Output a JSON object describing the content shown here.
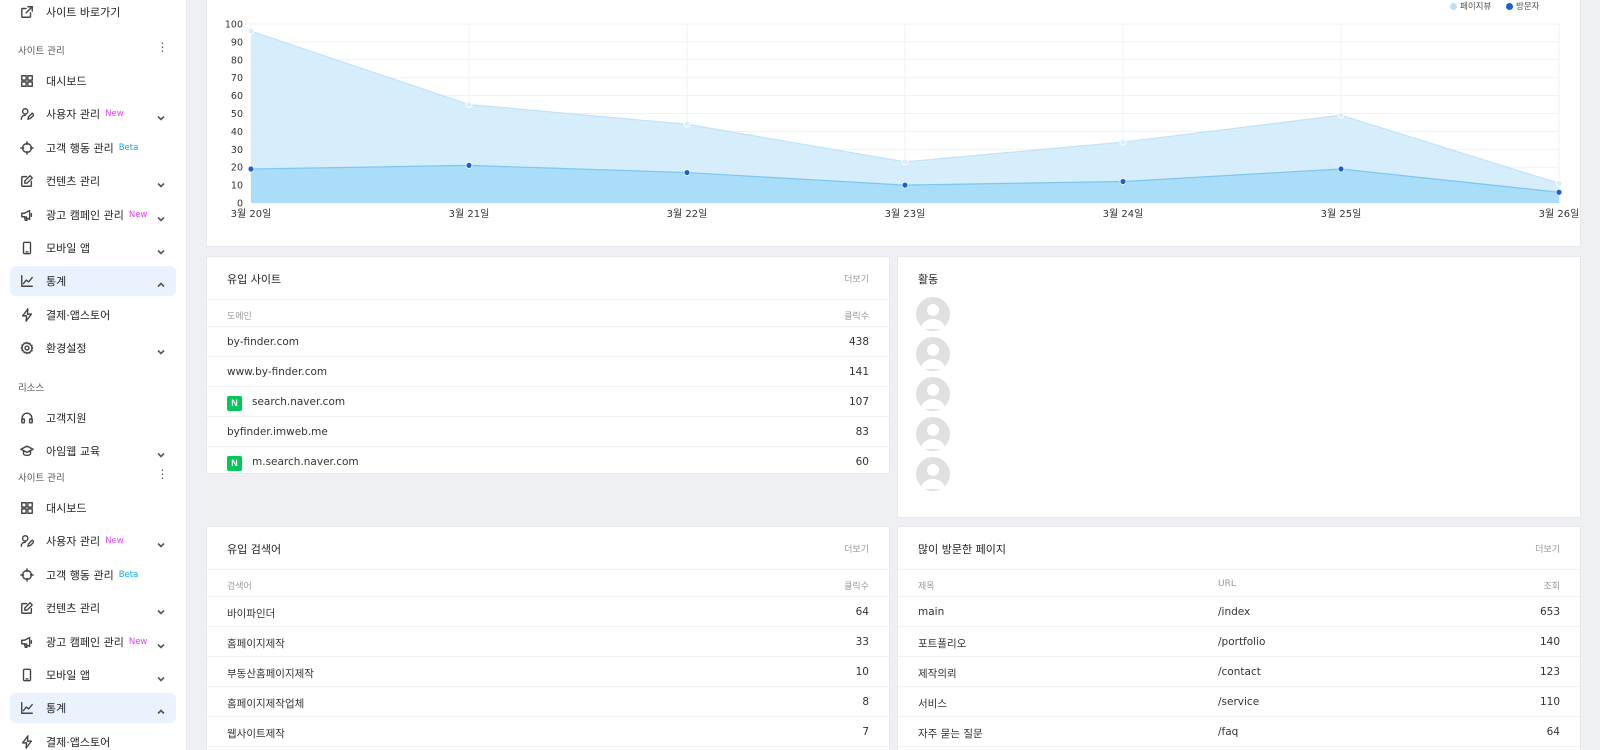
{
  "sidebar": {
    "top_link": "사이트 바로가기",
    "section1": "사이트 관리",
    "menu1": [
      {
        "label": "대시보드",
        "icon": "dashboard-icon",
        "badge": "",
        "chevron": ""
      },
      {
        "label": "사용자 관리",
        "icon": "user-edit-icon",
        "badge": "New",
        "chevron": "down"
      },
      {
        "label": "고객 행동 관리",
        "icon": "target-icon",
        "badge": "Beta",
        "chevron": ""
      },
      {
        "label": "컨텐츠 관리",
        "icon": "edit-icon",
        "badge": "",
        "chevron": "down"
      },
      {
        "label": "광고 캠페인 관리",
        "icon": "megaphone-icon",
        "badge": "New",
        "chevron": "down"
      },
      {
        "label": "모바일 앱",
        "icon": "mobile-icon",
        "badge": "",
        "chevron": "down"
      },
      {
        "label": "통계",
        "icon": "chart-line-icon",
        "badge": "",
        "chevron": "up"
      },
      {
        "label": "결제·앱스토어",
        "icon": "lightning-icon",
        "badge": "",
        "chevron": ""
      },
      {
        "label": "환경설정",
        "icon": "gear-icon",
        "badge": "",
        "chevron": "down"
      }
    ],
    "section2": "리소스",
    "menu2": [
      {
        "label": "고객지원",
        "icon": "headset-icon",
        "badge": "",
        "chevron": ""
      },
      {
        "label": "아임웹 교육",
        "icon": "graduation-cap-icon",
        "badge": "",
        "chevron": "down"
      }
    ],
    "section3": "사이트 관리",
    "menu3": [
      {
        "label": "대시보드",
        "icon": "dashboard-icon",
        "badge": "",
        "chevron": ""
      },
      {
        "label": "사용자 관리",
        "icon": "user-edit-icon",
        "badge": "New",
        "chevron": "down"
      },
      {
        "label": "고객 행동 관리",
        "icon": "target-icon",
        "badge": "Beta",
        "chevron": ""
      },
      {
        "label": "컨텐츠 관리",
        "icon": "edit-icon",
        "badge": "",
        "chevron": "down"
      },
      {
        "label": "광고 캠페인 관리",
        "icon": "megaphone-icon",
        "badge": "New",
        "chevron": "down"
      },
      {
        "label": "모바일 앱",
        "icon": "mobile-icon",
        "badge": "",
        "chevron": "down"
      },
      {
        "label": "통계",
        "icon": "chart-line-icon",
        "badge": "",
        "chevron": "up"
      },
      {
        "label": "결제·앱스토어",
        "icon": "lightning-icon",
        "badge": "",
        "chevron": ""
      }
    ]
  },
  "chart_data": {
    "type": "area",
    "categories": [
      "3월 20일",
      "3월 21일",
      "3월 22일",
      "3월 23일",
      "3월 24일",
      "3월 25일",
      "3월 26일"
    ],
    "series": [
      {
        "name": "페이지뷰",
        "values": [
          96,
          55,
          44,
          23,
          34,
          49,
          11
        ],
        "color": "#b9e0fa"
      },
      {
        "name": "방문자",
        "values": [
          19,
          21,
          17,
          10,
          12,
          19,
          6
        ],
        "color": "#1a5fd6"
      }
    ],
    "ylim": [
      0,
      100
    ],
    "yticks": [
      "0",
      "10",
      "20",
      "30",
      "40",
      "50",
      "60",
      "70",
      "80",
      "90",
      "100"
    ],
    "grid": true,
    "legend": "top-right"
  },
  "referrers": {
    "title": "유입 사이트",
    "more": "더보기",
    "col_domain": "도메인",
    "col_clicks": "클릭수",
    "rows": [
      {
        "domain": "by-finder.com",
        "clicks": "438",
        "naver": false
      },
      {
        "domain": "www.by-finder.com",
        "clicks": "141",
        "naver": false
      },
      {
        "domain": "search.naver.com",
        "clicks": "107",
        "naver": true
      },
      {
        "domain": "byfinder.imweb.me",
        "clicks": "83",
        "naver": false
      },
      {
        "domain": "m.search.naver.com",
        "clicks": "60",
        "naver": true
      }
    ]
  },
  "activity": {
    "title": "활동",
    "avatars": [
      "avatar",
      "avatar",
      "avatar",
      "avatar",
      "avatar"
    ]
  },
  "keywords": {
    "title": "유입 검색어",
    "more": "더보기",
    "col_keyword": "검색어",
    "col_clicks": "클릭수",
    "rows": [
      {
        "keyword": "바이파인더",
        "clicks": "64"
      },
      {
        "keyword": "홈페이지제작",
        "clicks": "33"
      },
      {
        "keyword": "부동산홈페이지제작",
        "clicks": "10"
      },
      {
        "keyword": "홈페이지제작업체",
        "clicks": "8"
      },
      {
        "keyword": "웹사이트제작",
        "clicks": "7"
      }
    ]
  },
  "pages": {
    "title": "많이 방문한 페이지",
    "more": "더보기",
    "col_title": "제목",
    "col_url": "URL",
    "col_views": "조회",
    "rows": [
      {
        "title": "main",
        "url": "/index",
        "views": "653"
      },
      {
        "title": "포트폴리오",
        "url": "/portfolio",
        "views": "140"
      },
      {
        "title": "제작의뢰",
        "url": "/contact",
        "views": "123"
      },
      {
        "title": "서비스",
        "url": "/service",
        "views": "110"
      },
      {
        "title": "자주 묻는 질문",
        "url": "/faq",
        "views": "64"
      }
    ]
  }
}
